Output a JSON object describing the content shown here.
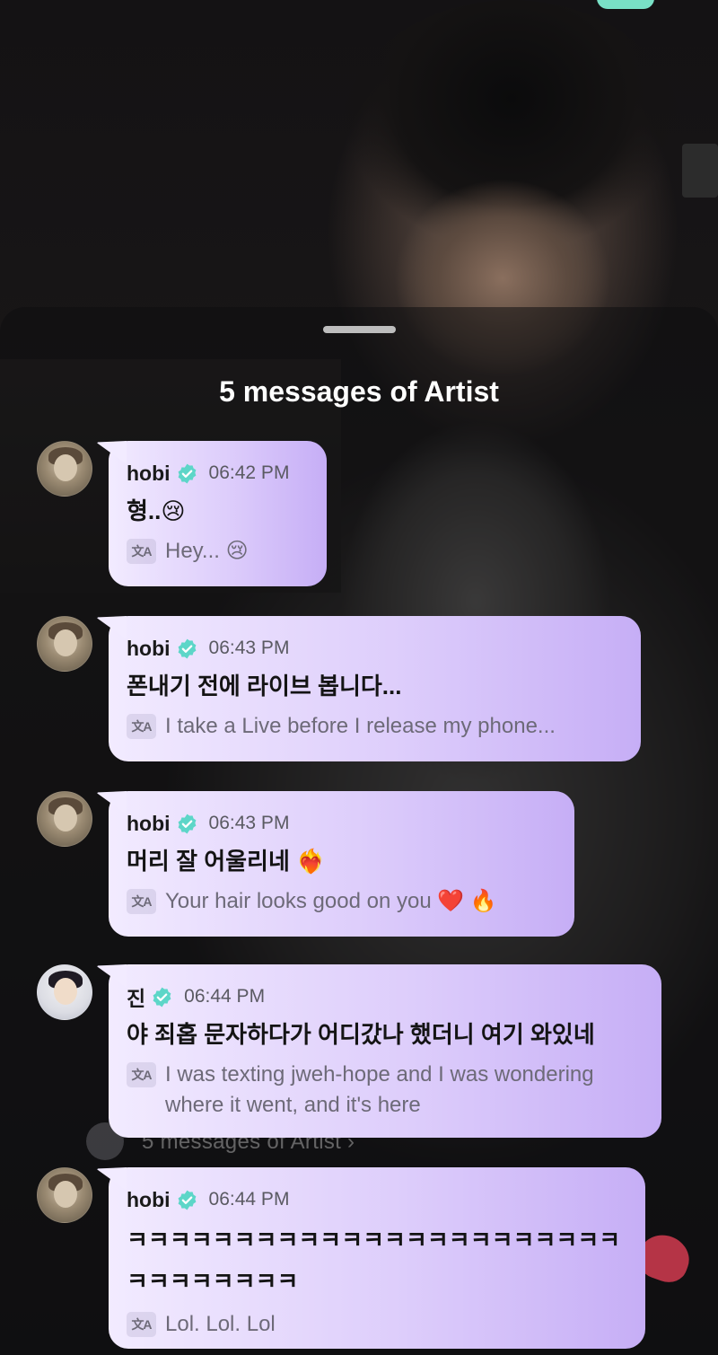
{
  "sheet": {
    "title": "5 messages of Artist"
  },
  "background": {
    "ghost_link": "5 messages of Artist ›"
  },
  "translate_icon": "文A",
  "messages": [
    {
      "name": "hobi",
      "time": "06:42 PM",
      "text": "형..😢",
      "translation": "Hey... 😢",
      "avatar": "hobi-avatar"
    },
    {
      "name": "hobi",
      "time": "06:43 PM",
      "text": "폰내기 전에 라이브 봅니다...",
      "translation": "I take a Live before I release my phone...",
      "avatar": "hobi-avatar"
    },
    {
      "name": "hobi",
      "time": "06:43 PM",
      "text": "머리 잘 어울리네 ❤️‍🔥",
      "translation": "Your hair looks good on you ❤️ 🔥",
      "avatar": "hobi-avatar"
    },
    {
      "name": "진",
      "time": "06:44 PM",
      "text": "야 죄홉 문자하다가 어디갔나 했더니 여기 와있네",
      "translation": "I was texting jweh-hope and I was wondering where it went, and it's here",
      "avatar": "jin-avatar"
    },
    {
      "name": "hobi",
      "time": "06:44 PM",
      "text": "ㅋㅋㅋㅋㅋㅋㅋㅋㅋㅋㅋㅋㅋㅋㅋㅋㅋㅋㅋㅋㅋㅋㅋㅋㅋㅋㅋㅋㅋㅋㅋ",
      "translation": "Lol. Lol. Lol",
      "avatar": "hobi-avatar"
    }
  ],
  "colors": {
    "bubble_start": "#f2ebff",
    "bubble_end": "#c6aef6",
    "verified": "#5dd6c8",
    "accent_decor": "#79e0c6"
  }
}
